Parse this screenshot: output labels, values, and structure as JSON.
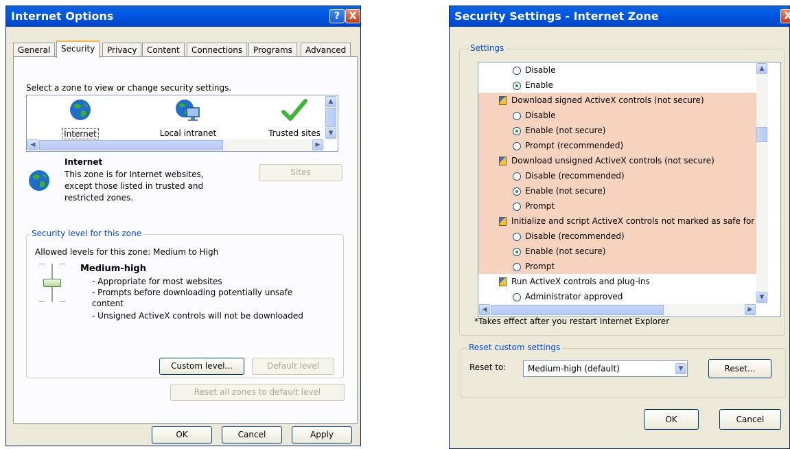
{
  "internet_options": {
    "title": "Internet Options",
    "help_glyph": "?",
    "close_glyph": "X",
    "tabs": [
      {
        "label": "General"
      },
      {
        "label": "Security",
        "active": true
      },
      {
        "label": "Privacy"
      },
      {
        "label": "Content"
      },
      {
        "label": "Connections"
      },
      {
        "label": "Programs"
      },
      {
        "label": "Advanced"
      }
    ],
    "select_zone_label": "Select a zone to view or change security settings.",
    "zones": [
      {
        "label": "Internet",
        "icon": "globe-icon"
      },
      {
        "label": "Local intranet",
        "icon": "intranet-icon"
      },
      {
        "label": "Trusted sites",
        "icon": "checkmark-icon"
      }
    ],
    "zone_info": {
      "name": "Internet",
      "line1": "This zone is for Internet websites,",
      "line2": "except those listed in trusted and",
      "line3": "restricted zones."
    },
    "sites_button": "Sites",
    "security_level_group": "Security level for this zone",
    "allowed_levels": "Allowed levels for this zone: Medium to High",
    "level_name": "Medium-high",
    "level_desc": [
      "- Appropriate for most websites",
      "- Prompts before downloading potentially unsafe",
      "content",
      "- Unsigned ActiveX controls will not be downloaded"
    ],
    "custom_level_button": "Custom level...",
    "default_level_button": "Default level",
    "reset_all_button": "Reset all zones to default level",
    "ok_button": "OK",
    "cancel_button": "Cancel",
    "apply_button": "Apply"
  },
  "security_settings": {
    "title": "Security Settings - Internet Zone",
    "close_glyph": "X",
    "settings_group": "Settings",
    "items": [
      {
        "text": "Disable",
        "kind": "radio",
        "checked": false,
        "highlight": false
      },
      {
        "text": "Enable",
        "kind": "radio",
        "checked": true,
        "highlight": false
      },
      {
        "text": "Download signed ActiveX controls (not secure)",
        "kind": "header",
        "highlight": true
      },
      {
        "text": "Disable",
        "kind": "radio",
        "checked": false,
        "highlight": true
      },
      {
        "text": "Enable (not secure)",
        "kind": "radio",
        "checked": true,
        "highlight": true
      },
      {
        "text": "Prompt (recommended)",
        "kind": "radio",
        "checked": false,
        "highlight": true
      },
      {
        "text": "Download unsigned ActiveX controls (not secure)",
        "kind": "header",
        "highlight": true
      },
      {
        "text": "Disable (recommended)",
        "kind": "radio",
        "checked": false,
        "highlight": true
      },
      {
        "text": "Enable (not secure)",
        "kind": "radio",
        "checked": true,
        "highlight": true
      },
      {
        "text": "Prompt",
        "kind": "radio",
        "checked": false,
        "highlight": true
      },
      {
        "text": "Initialize and script ActiveX controls not marked as safe for s",
        "kind": "header",
        "highlight": true
      },
      {
        "text": "Disable (recommended)",
        "kind": "radio",
        "checked": false,
        "highlight": true
      },
      {
        "text": "Enable (not secure)",
        "kind": "radio",
        "checked": true,
        "highlight": true
      },
      {
        "text": "Prompt",
        "kind": "radio",
        "checked": false,
        "highlight": true
      },
      {
        "text": "Run ActiveX controls and plug-ins",
        "kind": "header",
        "highlight": false
      },
      {
        "text": "Administrator approved",
        "kind": "radio",
        "checked": false,
        "highlight": false
      }
    ],
    "restart_note": "*Takes effect after you restart Internet Explorer",
    "reset_group": "Reset custom settings",
    "reset_to_label": "Reset to:",
    "reset_select_value": "Medium-high (default)",
    "reset_button": "Reset...",
    "ok_button": "OK",
    "cancel_button": "Cancel"
  }
}
